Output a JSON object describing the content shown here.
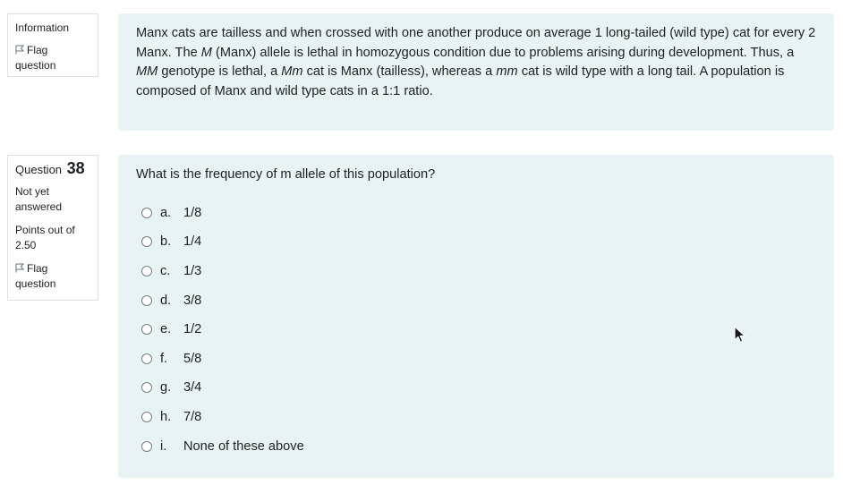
{
  "info_block": {
    "label": "Information",
    "flag_label": "Flag question",
    "text_parts": [
      "Manx cats are tailless and when crossed with one another produce on average 1 long-tailed (wild type) cat for every 2 Manx. The ",
      "M",
      " (Manx) allele is lethal in homozygous condition due to problems arising during development. Thus, a ",
      "MM",
      " genotype is lethal, a ",
      "Mm",
      " cat is Manx (tailless), whereas a ",
      "mm",
      " cat is wild type with a long tail.  A population is composed of Manx and wild type cats in a 1:1 ratio."
    ]
  },
  "question": {
    "number_label": "Question",
    "number": "38",
    "state": "Not yet answered",
    "grade_label": "Points out of",
    "grade_value": "2.50",
    "flag_label": "Flag question",
    "text": "What is the frequency of m allele of this population?",
    "options": [
      {
        "letter": "a.",
        "text": "1/8"
      },
      {
        "letter": "b.",
        "text": "1/4"
      },
      {
        "letter": "c.",
        "text": "1/3"
      },
      {
        "letter": "d.",
        "text": "3/8"
      },
      {
        "letter": "e.",
        "text": "1/2"
      },
      {
        "letter": "f.",
        "text": "5/8"
      },
      {
        "letter": "g.",
        "text": "3/4"
      },
      {
        "letter": "h.",
        "text": "7/8"
      },
      {
        "letter": "i.",
        "text": "None of these above"
      }
    ]
  },
  "icons": {
    "flag": "flag-icon",
    "cursor": "mouse-cursor-icon"
  }
}
